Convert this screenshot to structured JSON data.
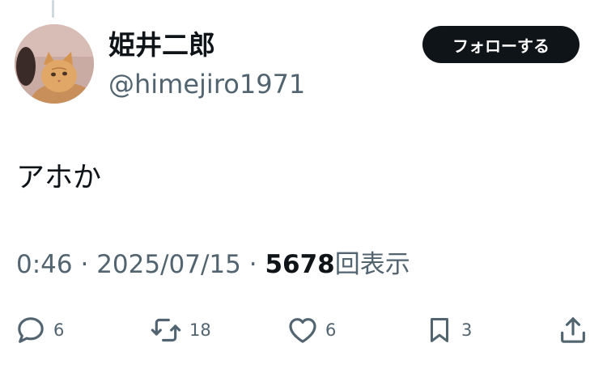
{
  "tweet": {
    "author": {
      "display_name": "姫井二郎",
      "handle": "@himejiro1971",
      "avatar": "orange-cat-photo"
    },
    "follow_label": "フォローする",
    "text": "アホか",
    "time": "0:46",
    "separator": "·",
    "date": "2025/07/15",
    "views_count": "5678",
    "views_label": "回表示"
  },
  "actions": {
    "reply": {
      "icon": "reply-icon",
      "count": "6"
    },
    "retweet": {
      "icon": "retweet-icon",
      "count": "18"
    },
    "like": {
      "icon": "heart-icon",
      "count": "6"
    },
    "bookmark": {
      "icon": "bookmark-icon",
      "count": "3"
    },
    "share": {
      "icon": "share-icon"
    }
  },
  "colors": {
    "text": "#0f1419",
    "secondary": "#536471",
    "follow_bg": "#0f1419",
    "follow_text": "#ffffff",
    "thread_line": "#cfd9de"
  }
}
